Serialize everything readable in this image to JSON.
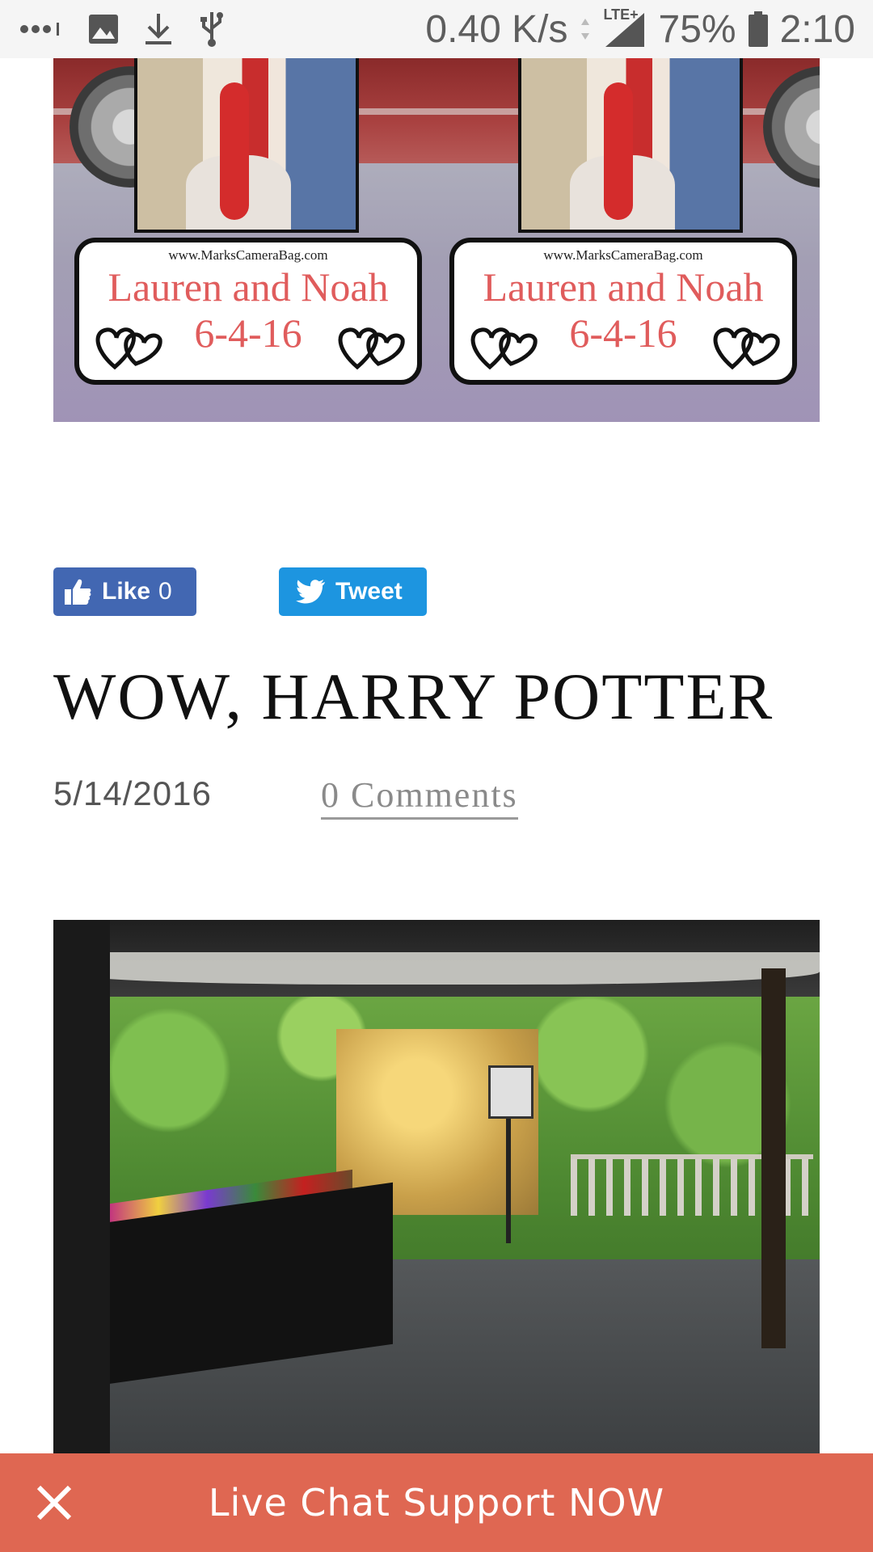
{
  "status_bar": {
    "icons_left": [
      "more-dots-icon",
      "image-icon",
      "download-icon",
      "usb-icon"
    ],
    "speed": "0.40 K/s",
    "network": "LTE+",
    "battery": "75%",
    "time": "2:10"
  },
  "top_image": {
    "cards": [
      {
        "url": "www.MarksCameraBag.com",
        "names": "Lauren and Noah",
        "date": "6-4-16"
      },
      {
        "url": "www.MarksCameraBag.com",
        "names": "Lauren and Noah",
        "date": "6-4-16"
      }
    ]
  },
  "share": {
    "like_label": "Like",
    "like_count": "0",
    "tweet_label": "Tweet"
  },
  "post": {
    "title": "WOW, HARRY POTTER",
    "date": "5/14/2016",
    "comments": "0 Comments"
  },
  "chat": {
    "label": "Live Chat Support NOW"
  },
  "colors": {
    "facebook": "#4267b2",
    "twitter": "#1d95e0",
    "chat_bar": "#df6752"
  }
}
